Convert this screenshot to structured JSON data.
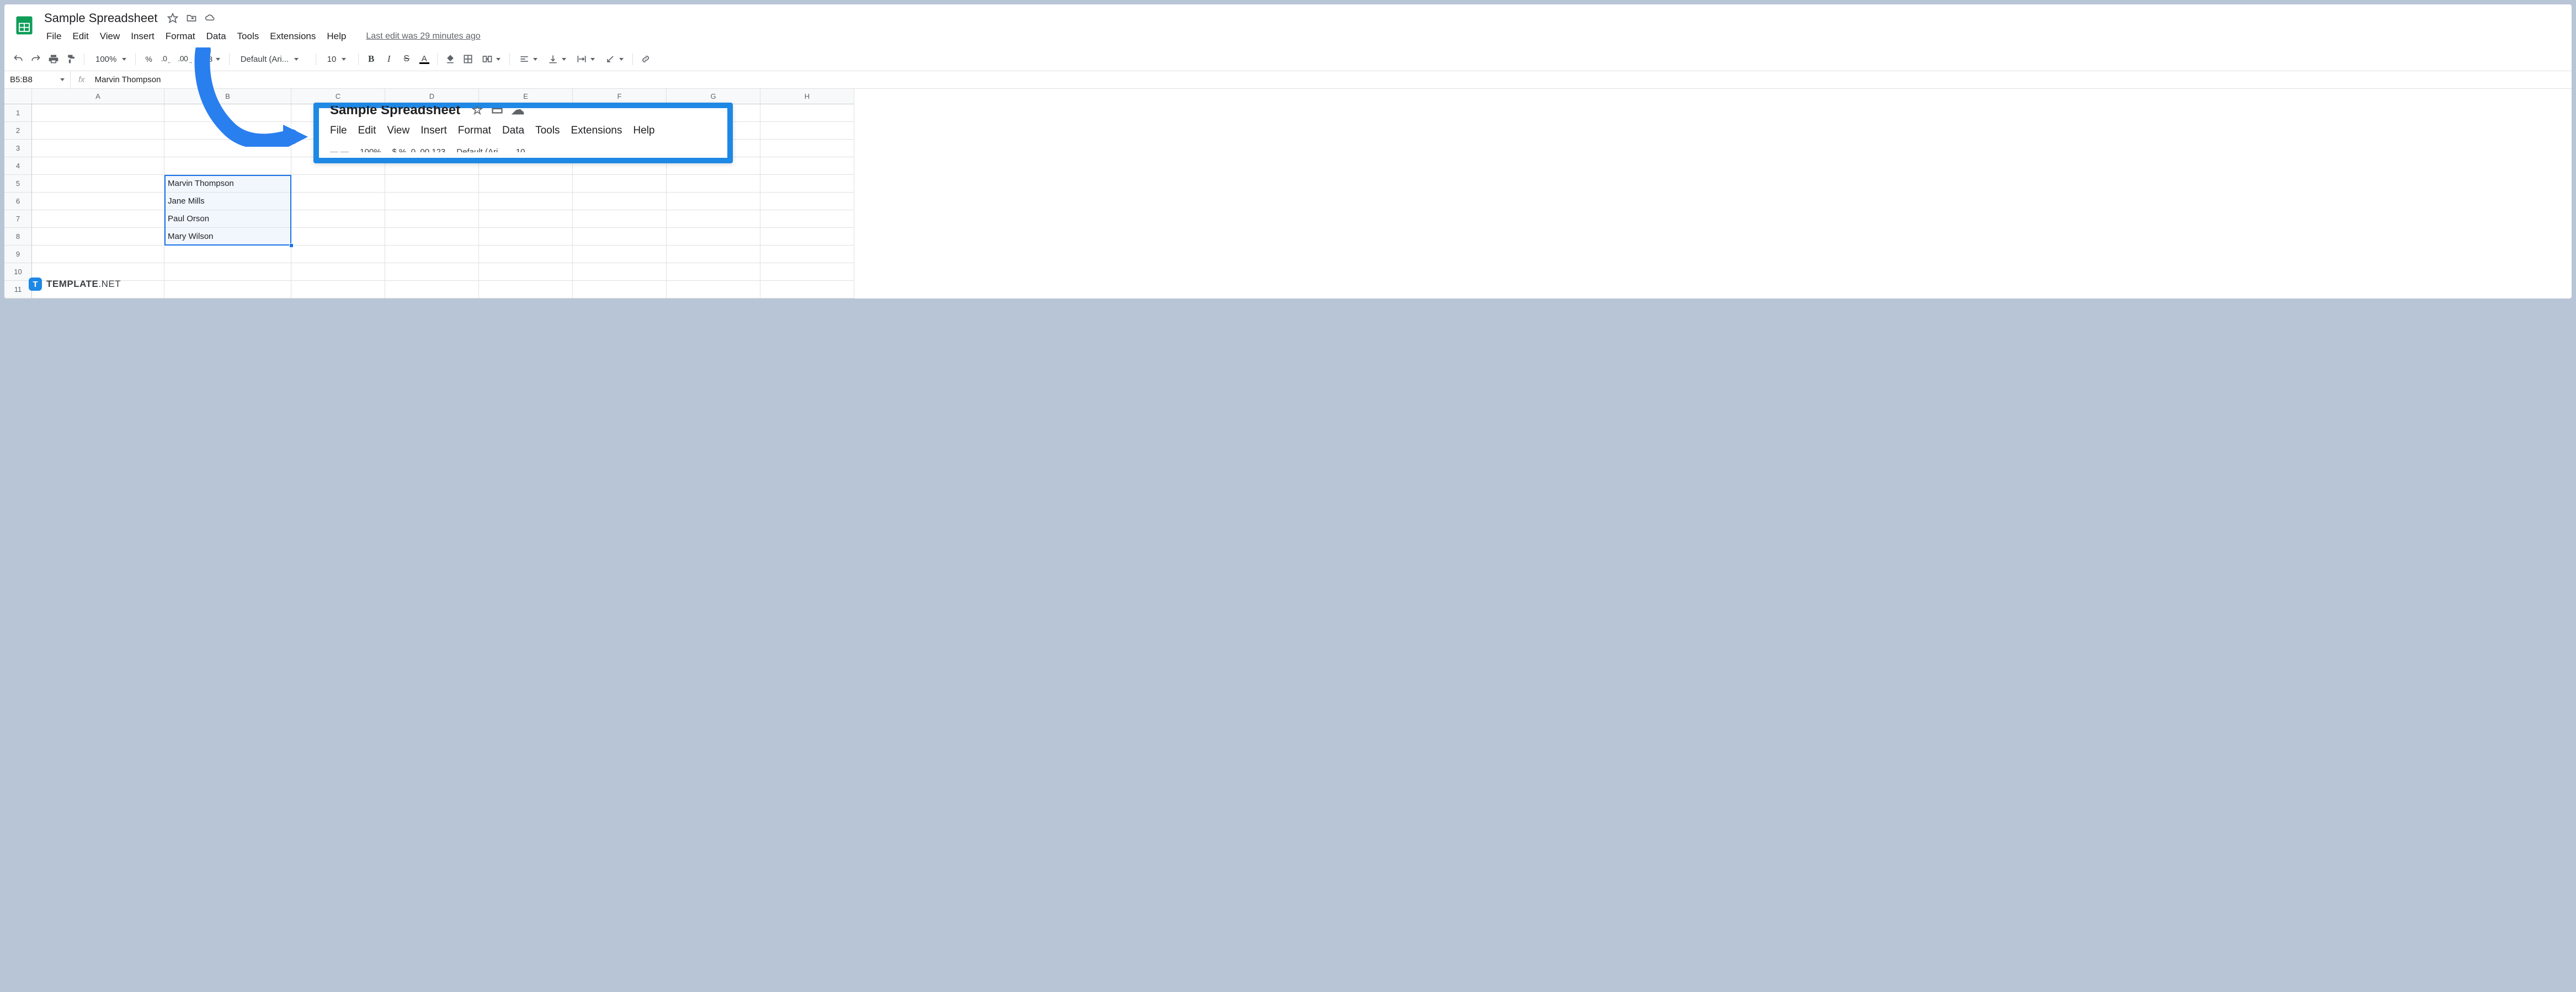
{
  "doc_title": "Sample Spreadsheet",
  "menus": [
    "File",
    "Edit",
    "View",
    "Insert",
    "Format",
    "Data",
    "Tools",
    "Extensions",
    "Help"
  ],
  "last_edit": "Last edit was 29 minutes ago",
  "toolbar": {
    "zoom": "100%",
    "font": "Default (Ari...",
    "font_size": "10",
    "number_formats": {
      "percent": "%",
      "dec_dec": ".0",
      "dec_inc": ".00",
      "more": "123"
    }
  },
  "name_box": "B5:B8",
  "formula_value": "Marvin Thompson",
  "columns": [
    "A",
    "B",
    "C",
    "D",
    "E",
    "F",
    "G",
    "H"
  ],
  "rows": [
    1,
    2,
    3,
    4,
    5,
    6,
    7,
    8,
    9,
    10,
    11
  ],
  "cells": {
    "B5": "Marvin Thompson",
    "B6": "Jane Mills",
    "B7": "Paul Orson",
    "B8": "Mary Wilson"
  },
  "callout": {
    "title": "Sample Spreadsheet",
    "menus": [
      "File",
      "Edit",
      "View",
      "Insert",
      "Format",
      "Data",
      "Tools",
      "Extensions",
      "Help"
    ]
  },
  "watermark": {
    "badge": "T",
    "text_bold": "TEMPLATE",
    "text_light": ".NET"
  }
}
